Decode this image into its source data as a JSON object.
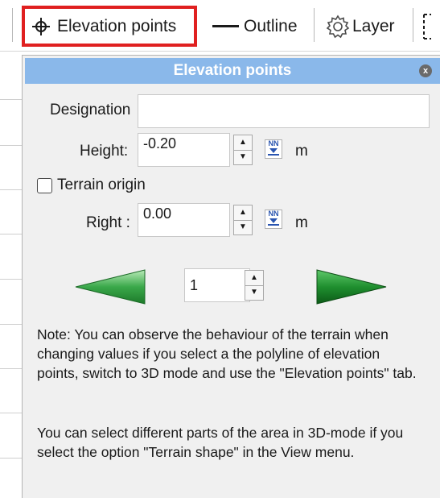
{
  "toolbar": {
    "active_tool_label": "Elevation points",
    "outline_label": "Outline",
    "layer_label": "Layer",
    "icons": [
      "crosshair-icon",
      "line-icon",
      "gear-icon",
      "more-icon"
    ],
    "active_color": "#e02020"
  },
  "panel": {
    "title": "Elevation points",
    "close_label": "x",
    "title_bar_color": "#8ab8ea",
    "designation": {
      "label": "Designation",
      "value": ""
    },
    "height": {
      "label": "Height:",
      "value": "-0.20",
      "unit": "m",
      "reference_icon_label": "NN"
    },
    "terrain_origin": {
      "label": "Terrain origin",
      "checked": false
    },
    "right": {
      "label": "Right :",
      "value": "0.00",
      "unit": "m",
      "reference_icon_label": "NN"
    },
    "navigation": {
      "current": "1",
      "prev_color": "#3aa84a",
      "next_color": "#1f8f2f"
    },
    "note_1": "Note: You can observe the behaviour of the terrain when changing values if you select a the polyline of elevation points, switch to 3D mode and use the \"Elevation points\" tab.",
    "note_2": "You can select different parts of the area in 3D-mode if you select the option \"Terrain shape\" in the View menu."
  }
}
